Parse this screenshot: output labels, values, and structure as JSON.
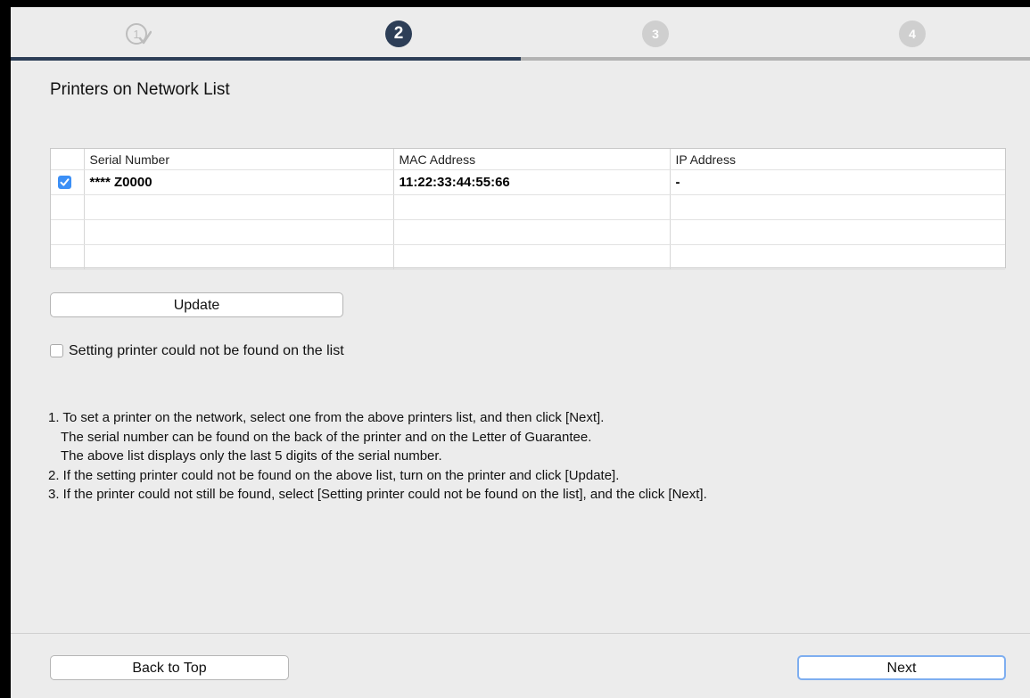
{
  "steps": [
    {
      "label": "1",
      "state": "completed",
      "icon": "check-circle-icon"
    },
    {
      "label": "2",
      "state": "current"
    },
    {
      "label": "3",
      "state": "upcoming"
    },
    {
      "label": "4",
      "state": "upcoming"
    }
  ],
  "progress": {
    "completed_fraction": 0.5
  },
  "title": "Printers on Network List",
  "table": {
    "headers": [
      "Serial Number",
      "MAC Address",
      "IP Address"
    ],
    "rows": [
      {
        "checked": true,
        "serial": "**** Z0000",
        "mac": "11:22:33:44:55:66",
        "ip": "-"
      }
    ],
    "empty_rows": 3
  },
  "buttons": {
    "update": "Update",
    "back": "Back to Top",
    "next": "Next"
  },
  "notfound_checkbox": {
    "label": "Setting printer could not be found on the list",
    "checked": false
  },
  "instructions": [
    "1. To set a printer on the network, select one from the above printers list, and then click [Next].",
    "The serial number can be found on the back of the printer and on the Letter of Guarantee.",
    "The above list displays only the last 5 digits of the serial number.",
    "2. If the setting printer could not be found on the above list, turn on the printer and click [Update].",
    "3. If the printer could not still be found, select [Setting printer could not be found on the list], and the click [Next]."
  ],
  "colors": {
    "accent": "#2d3e57",
    "checkbox_blue": "#3b8ff6",
    "inactive_step": "#cfcfcf"
  }
}
